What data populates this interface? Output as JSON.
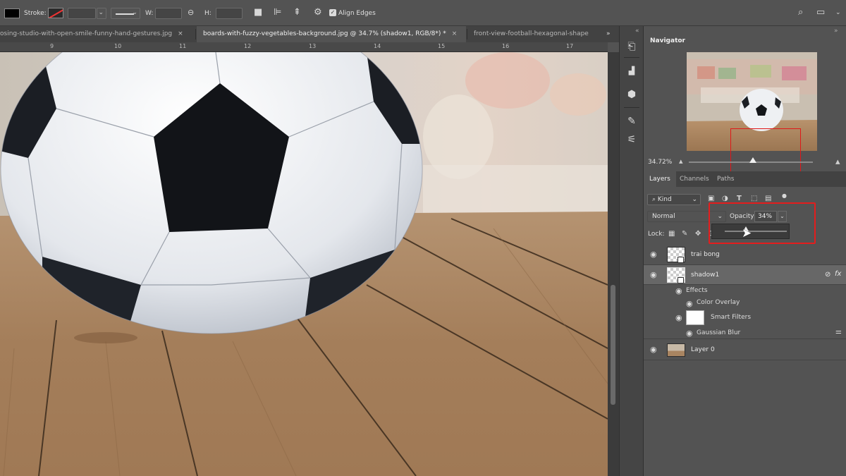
{
  "options_bar": {
    "stroke_label": "Stroke:",
    "w_label": "W:",
    "h_label": "H:",
    "align_edges_label": "Align Edges",
    "align_edges_checked": true,
    "icons": [
      "fill-swatch",
      "stroke-swatch",
      "line-style",
      "link-icon",
      "path-operations-icon",
      "path-alignment-icon",
      "path-arrangement-icon",
      "gear-icon",
      "search-icon",
      "workspace-icon",
      "share-icon"
    ]
  },
  "tabs": [
    {
      "label": "osing-studio-with-open-smile-funny-hand-gestures.jpg",
      "close": "×",
      "active": false
    },
    {
      "label": "boards-with-fuzzy-vegetables-background.jpg @ 34.7% (shadow1, RGB/8*) *",
      "close": "×",
      "active": true
    },
    {
      "label": "front-view-football-hexagonal-shape",
      "close": "",
      "active": false
    }
  ],
  "tabs_overflow": "»",
  "ruler": {
    "labels": [
      "9",
      "10",
      "11",
      "12",
      "13",
      "14",
      "15",
      "16",
      "17"
    ]
  },
  "navigator": {
    "title": "Navigator",
    "zoom": "34.72%",
    "zoom_fraction": 0.72
  },
  "layers_panel": {
    "tabs": [
      "Layers",
      "Channels",
      "Paths"
    ],
    "active_tab": "Layers",
    "filter_label": "Kind",
    "blend_mode": "Normal",
    "opacity_label": "Opacity:",
    "opacity_value": "34%",
    "opacity_fraction": 0.34,
    "lock_label": "Lock:",
    "layers": [
      {
        "name": "trai bong",
        "visible": true,
        "type": "smart-object"
      },
      {
        "name": "shadow1",
        "visible": true,
        "type": "smart-object",
        "selected": true,
        "fx": "fx"
      },
      {
        "name": "Layer 0",
        "visible": true,
        "type": "image"
      }
    ],
    "shadow1_effects": {
      "effects_label": "Effects",
      "color_overlay": "Color Overlay",
      "smart_filters": "Smart Filters",
      "gaussian_blur": "Gaussian Blur"
    }
  },
  "colors": {
    "panel_bg": "#535353",
    "highlight_box": "#e41d1d",
    "navigator_view_rect": "#e01818"
  }
}
